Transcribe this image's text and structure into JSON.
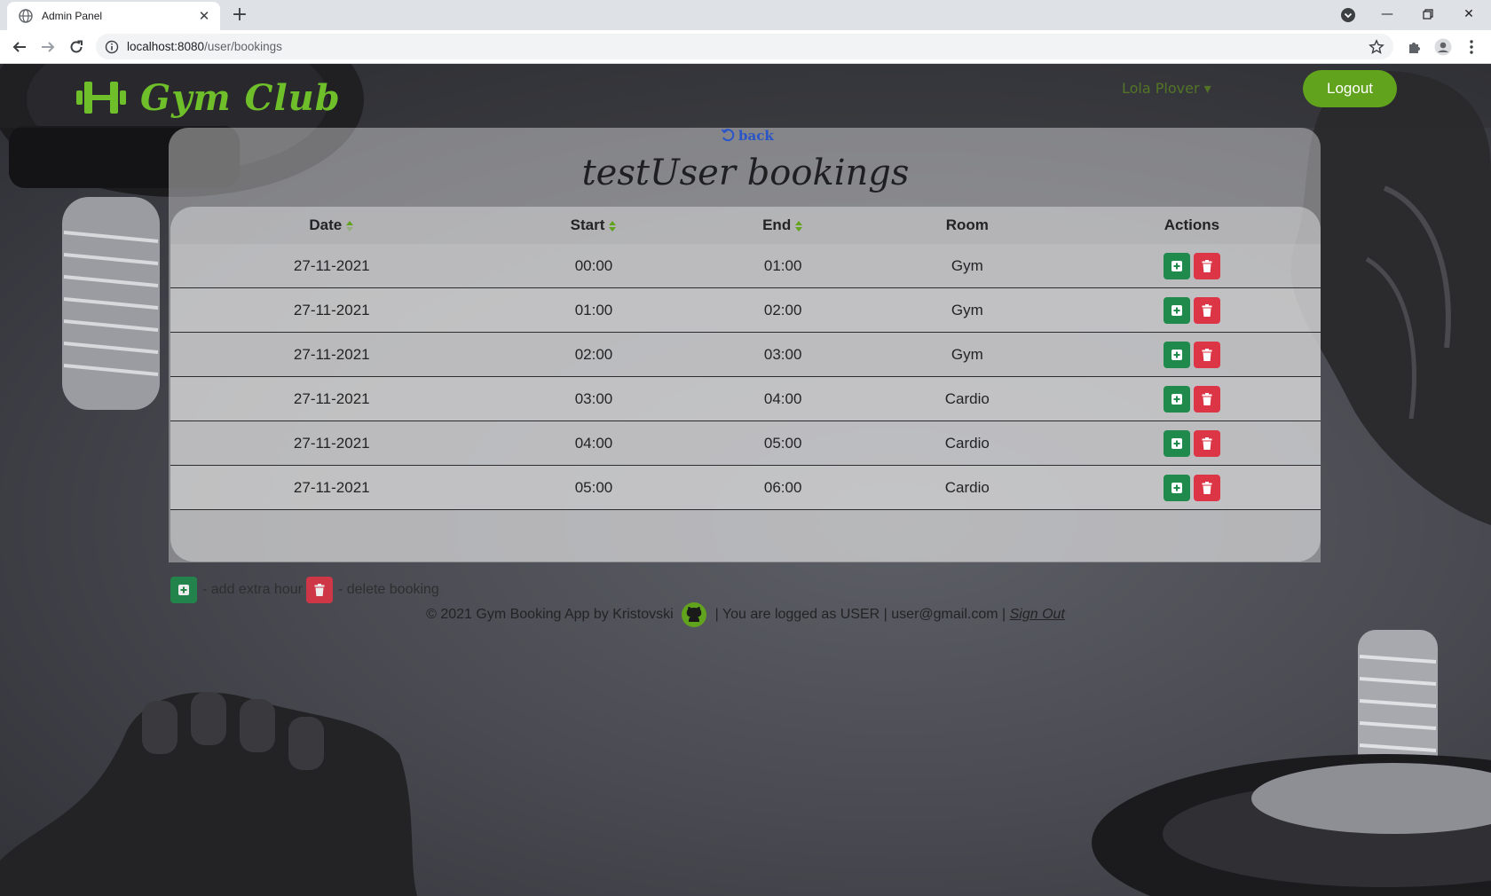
{
  "browser": {
    "tab_title": "Admin Panel",
    "url_host": "localhost:8080",
    "url_path": "/user/bookings"
  },
  "header": {
    "brand": "Gym Club",
    "user_menu": "Lola Plover ▾",
    "logout_label": "Logout",
    "brand_color": "#6fbf2a"
  },
  "main": {
    "back_label": "back",
    "title": "testUser bookings",
    "columns": [
      "Date",
      "Start",
      "End",
      "Room",
      "Actions"
    ],
    "rows": [
      {
        "date": "27-11-2021",
        "start": "00:00",
        "end": "01:00",
        "room": "Gym"
      },
      {
        "date": "27-11-2021",
        "start": "01:00",
        "end": "02:00",
        "room": "Gym"
      },
      {
        "date": "27-11-2021",
        "start": "02:00",
        "end": "03:00",
        "room": "Gym"
      },
      {
        "date": "27-11-2021",
        "start": "03:00",
        "end": "04:00",
        "room": "Cardio"
      },
      {
        "date": "27-11-2021",
        "start": "04:00",
        "end": "05:00",
        "room": "Cardio"
      },
      {
        "date": "27-11-2021",
        "start": "05:00",
        "end": "06:00",
        "room": "Cardio"
      }
    ]
  },
  "legend": {
    "add_text": "- add extra hour",
    "delete_text": "- delete booking"
  },
  "footer": {
    "copyright": "© 2021 Gym Booking App by Kristovski",
    "logged_as": "| You are logged as USER | user@gmail.com |",
    "sign_out": "Sign Out"
  },
  "colors": {
    "add_button": "#1f8a4c",
    "delete_button": "#dc3545",
    "logout_button": "#62a31d",
    "link": "#2a55c9"
  }
}
